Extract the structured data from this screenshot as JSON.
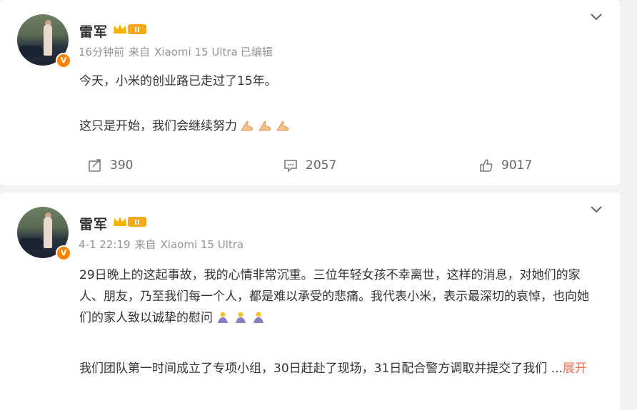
{
  "posts": [
    {
      "author": "雷军",
      "level_badge": "II",
      "verified_badge": "V",
      "time": "16分钟前",
      "source_prefix": "来自",
      "source": "Xiaomi 15 Ultra",
      "edited": "已编辑",
      "paragraphs": [
        "今天，小米的创业路已走过了15年。",
        "这只是开始，我们会继续努力"
      ],
      "reposts": "390",
      "comments": "2057",
      "likes": "9017"
    },
    {
      "author": "雷军",
      "level_badge": "II",
      "verified_badge": "V",
      "time": "4-1 22:19",
      "source_prefix": "来自",
      "source": "Xiaomi 15 Ultra",
      "paragraphs": [
        "29日晚上的这起事故，我的心情非常沉重。三位年轻女孩不幸离世，这样的消息，对她们的家人、朋友，乃至我们每一个人，都是难以承受的悲痛。我代表小米，表示最深切的哀悼，也向她们的家人致以诚挚的慰问",
        "我们团队第一时间成立了专项小组，30日赶赴了现场，31日配合警方调取并提交了我们 ..."
      ],
      "expand_label": "展开"
    }
  ],
  "icons": {
    "chevron": "chevron-down-icon",
    "repost": "repost-icon",
    "comment": "comment-icon",
    "like": "thumbs-up-icon",
    "emoji_clap": "folded-hands-emoji",
    "emoji_pray": "pray-emoji"
  },
  "colors": {
    "verified": "#ff8200",
    "crown": "#f4b400",
    "link": "#eb7350",
    "meta": "#939393"
  }
}
